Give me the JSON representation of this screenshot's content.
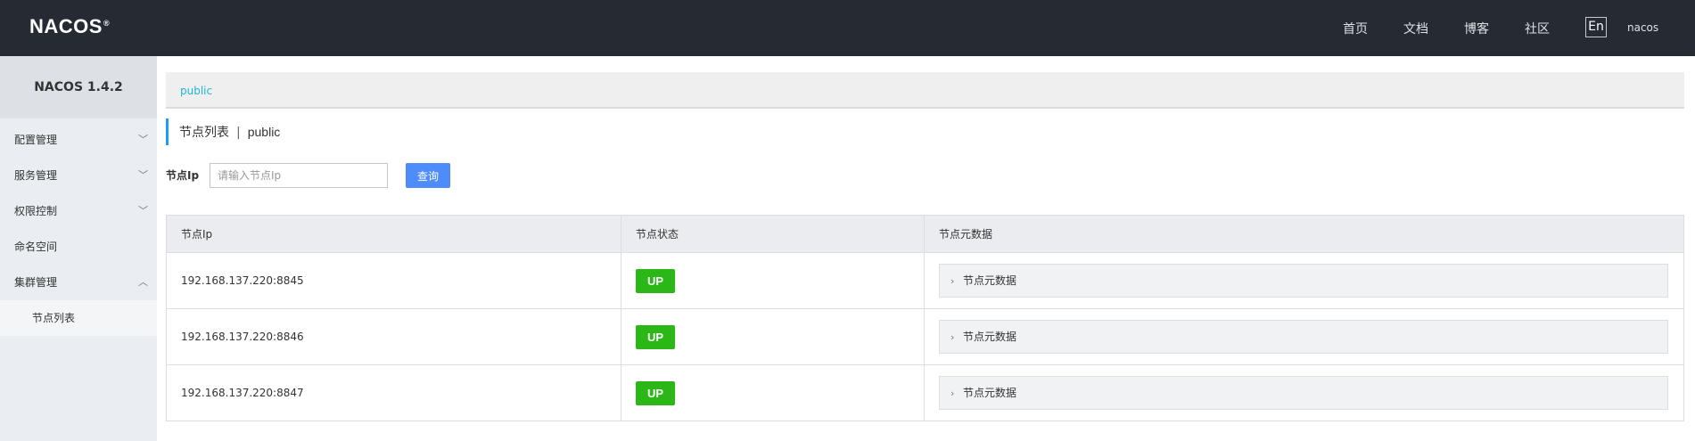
{
  "header": {
    "logo": "NACOS",
    "logo_reg": "®",
    "nav": [
      {
        "label": "首页"
      },
      {
        "label": "文档"
      },
      {
        "label": "博客"
      },
      {
        "label": "社区"
      }
    ],
    "lang_button": "En",
    "user": "nacos"
  },
  "sidebar": {
    "title": "NACOS 1.4.2",
    "items": [
      {
        "label": "配置管理",
        "icon": "chevron-down-icon"
      },
      {
        "label": "服务管理",
        "icon": "chevron-down-icon"
      },
      {
        "label": "权限控制",
        "icon": "chevron-down-icon"
      },
      {
        "label": "命名空间"
      },
      {
        "label": "集群管理",
        "icon": "chevron-up-icon"
      }
    ],
    "sub_items": [
      {
        "label": "节点列表"
      }
    ]
  },
  "namespace": {
    "active": "public"
  },
  "page": {
    "title": "节点列表",
    "separator": "|",
    "namespace": "public"
  },
  "search": {
    "label": "节点Ip",
    "placeholder": "请输入节点Ip",
    "button": "查询"
  },
  "table": {
    "columns": [
      "节点Ip",
      "节点状态",
      "节点元数据"
    ],
    "rows": [
      {
        "ip": "192.168.137.220:8845",
        "status": "UP",
        "metadata": "节点元数据"
      },
      {
        "ip": "192.168.137.220:8846",
        "status": "UP",
        "metadata": "节点元数据"
      },
      {
        "ip": "192.168.137.220:8847",
        "status": "UP",
        "metadata": "节点元数据"
      }
    ]
  },
  "colors": {
    "header_bg": "#252a33",
    "sidebar_bg": "#eaedf1",
    "accent": "#4d8cfa",
    "namespace_link": "#1eb4d6",
    "status_up": "#2bb817"
  }
}
